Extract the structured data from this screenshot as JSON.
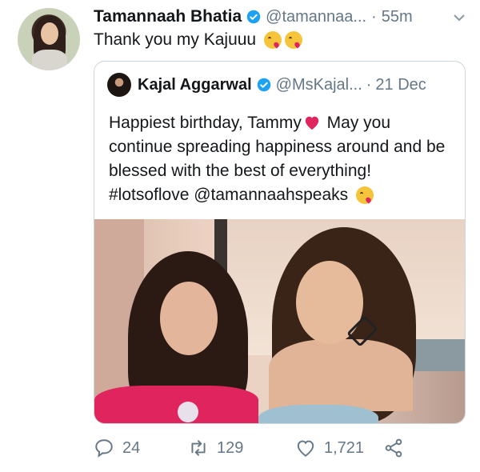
{
  "tweet": {
    "author_name": "Tamannaah Bhatia",
    "handle": "@tamannaa...",
    "separator": "·",
    "time": "55m",
    "text": "Thank you my Kajuuu"
  },
  "quoted_tweet": {
    "author_name": "Kajal Aggarwal",
    "handle": "@MsKajal...",
    "separator": "·",
    "time": "21 Dec",
    "text_part1": "Happiest birthday, Tammy",
    "text_part2": " May you continue spreading happiness around and be blessed with the best of everything! #lotsoflove @tamannaahspeaks"
  },
  "actions": {
    "reply_count": "24",
    "retweet_count": "129",
    "like_count": "1,721"
  },
  "colors": {
    "verified": "#1da1f2",
    "text_secondary": "#657786",
    "heart": "#e0245e"
  }
}
